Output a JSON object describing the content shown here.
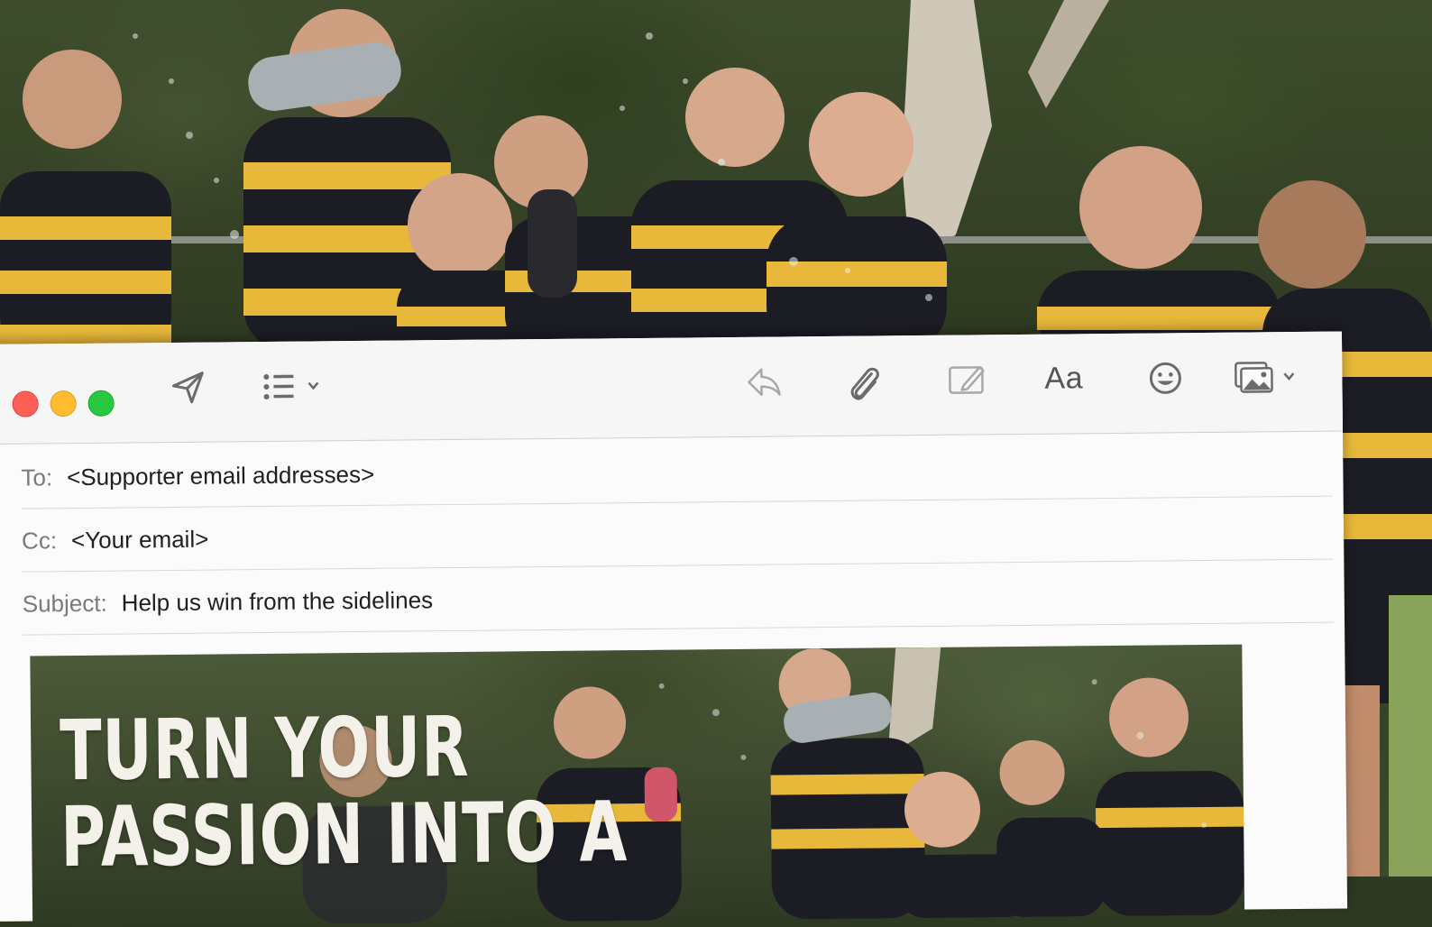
{
  "header": {
    "to_label": "To:",
    "to_value": "<Supporter email addresses>",
    "cc_label": "Cc:",
    "cc_value": "<Your email>",
    "subject_label": "Subject:",
    "subject_value": "Help us win from the sidelines"
  },
  "toolbar": {
    "format_label": "Aa",
    "icons": [
      "send-icon",
      "list-icon",
      "reply-icon",
      "attachment-icon",
      "markup-icon",
      "format-text-icon",
      "emoji-icon",
      "photo-browser-icon"
    ]
  },
  "banner": {
    "headline_line1": "TURN YOUR",
    "headline_line2": "PASSION INTO A"
  },
  "colors": {
    "traffic_red": "#ff5f57",
    "traffic_yellow": "#febc2e",
    "traffic_green": "#28c840",
    "jersey_yellow": "#e8b83a",
    "jersey_black": "#1c1c24"
  }
}
